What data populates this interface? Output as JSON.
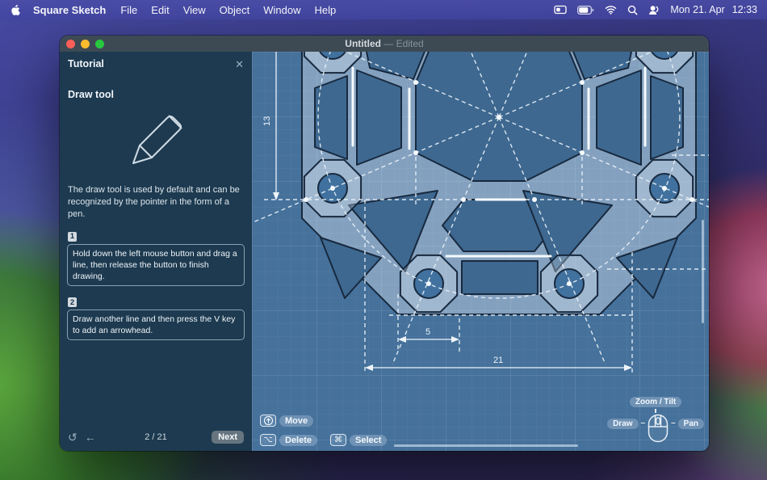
{
  "menu_bar": {
    "app_name": "Square Sketch",
    "menus": [
      "File",
      "Edit",
      "View",
      "Object",
      "Window",
      "Help"
    ],
    "status": {
      "date": "Mon 21. Apr",
      "time": "12:33"
    }
  },
  "window": {
    "title": "Untitled",
    "title_separator": "—",
    "edited_label": "Edited"
  },
  "tutorial": {
    "title": "Tutorial",
    "close_glyph": "✕",
    "heading": "Draw tool",
    "body": "The draw tool is used by default and can be recognized by the pointer in the form of a pen.",
    "steps": [
      {
        "num": "1",
        "text": "Hold down the left mouse button and drag a line, then release the button to finish drawing."
      },
      {
        "num": "2",
        "text": "Draw another line and then press the V key to add an arrowhead."
      }
    ],
    "footer": {
      "reset_glyph": "↺",
      "back_glyph": "←",
      "progress": "2 / 21",
      "next_label": "Next"
    }
  },
  "canvas": {
    "dimensions": {
      "d13": "13",
      "d5": "5",
      "d21": "21"
    },
    "hints": {
      "move": "Move",
      "delete": "Delete",
      "select": "Select",
      "option_glyph": "⌥",
      "command_glyph": "⌘"
    },
    "mouse_legend": {
      "zoom_tilt": "Zoom / Tilt",
      "draw": "Draw",
      "pan": "Pan",
      "dash": "–"
    }
  },
  "colors": {
    "canvas_bg": "#45719b",
    "cutout": "#3e6890",
    "outline_navy": "#18293e",
    "panel_bg": "#1d3a50",
    "titlebar": "#3d4a54",
    "menubar_accent": "#4548a0",
    "traffic_red": "#ff5f57",
    "traffic_yellow": "#febc2e",
    "traffic_green": "#28c840",
    "blueprint_line": "#eef4f9"
  }
}
